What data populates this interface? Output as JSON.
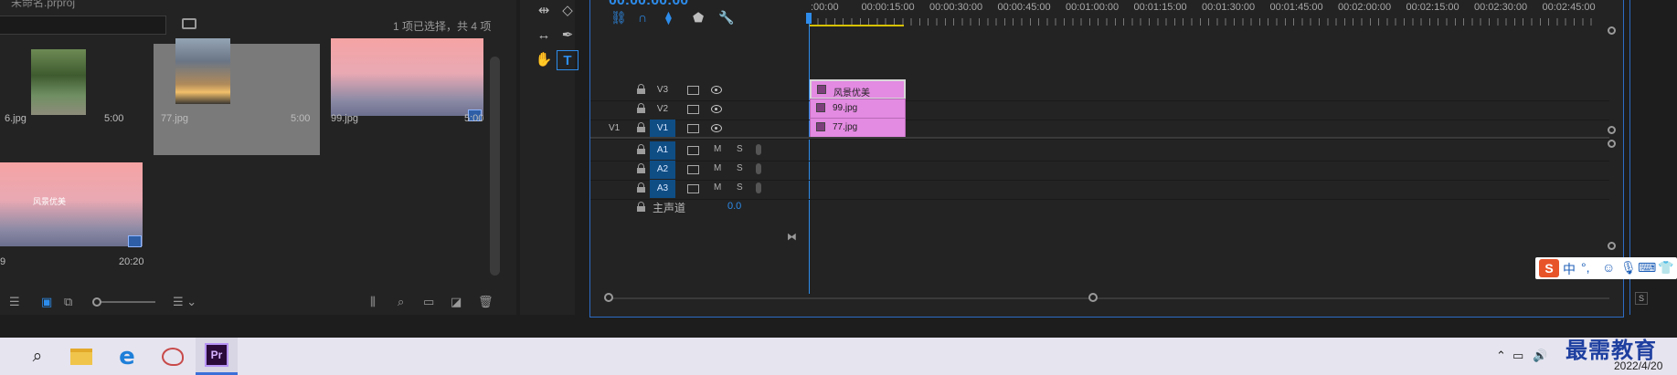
{
  "project": {
    "name": "未命名.prproj",
    "selection_status": "1 项已选择，共 4 项",
    "items": [
      {
        "name": "6.jpg",
        "duration": "5:00",
        "thumb": "tree"
      },
      {
        "name": "77.jpg",
        "duration": "5:00",
        "thumb": "street"
      },
      {
        "name": "99.jpg",
        "duration": "5:00",
        "thumb": "gradient"
      },
      {
        "name": "9",
        "duration": "20:20",
        "thumb": "title",
        "thumb_text": "风景优美"
      }
    ]
  },
  "tools": {
    "items": [
      "ripple-edit",
      "razor",
      "slip",
      "pen",
      "hand",
      "type"
    ]
  },
  "timeline": {
    "timecode": "00:00:00:00",
    "ruler_labels": [
      ":00:00",
      "00:00:15:00",
      "00:00:30:00",
      "00:00:45:00",
      "00:01:00:00",
      "00:01:15:00",
      "00:01:30:00",
      "00:01:45:00",
      "00:02:00:00",
      "00:02:15:00",
      "00:02:30:00",
      "00:02:45:00"
    ],
    "video_tracks": [
      {
        "name": "V3",
        "source": "",
        "clip": "风景优美"
      },
      {
        "name": "V2",
        "source": "",
        "clip": "99.jpg"
      },
      {
        "name": "V1",
        "source": "V1",
        "clip": "77.jpg"
      }
    ],
    "audio_tracks": [
      {
        "name": "A1",
        "m": "M",
        "s": "S"
      },
      {
        "name": "A2",
        "m": "M",
        "s": "S"
      },
      {
        "name": "A3",
        "m": "M",
        "s": "S"
      }
    ],
    "master": {
      "label": "主声道",
      "value": "0.0"
    }
  },
  "ime": {
    "items": [
      "中",
      "°,",
      "☺",
      "🎙",
      "⌨",
      "👕"
    ]
  },
  "right_panel": {
    "solo_label": "S"
  },
  "taskbar": {
    "watermark": "最需教育",
    "date": "2022/4/20"
  },
  "colors": {
    "accent": "#2d8ceb",
    "clip": "#e38ae2",
    "selected_track": "#0f4d85",
    "work_area": "#d6c200"
  }
}
